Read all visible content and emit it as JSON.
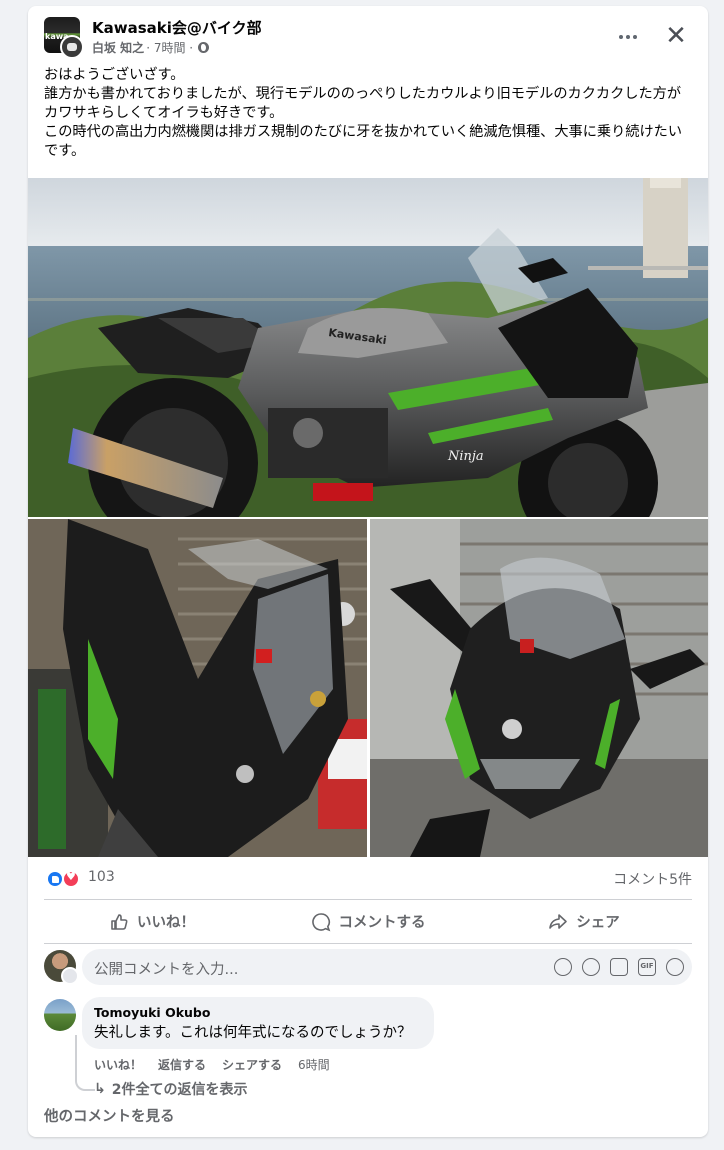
{
  "post": {
    "group_name": "Kawasaki会@バイク部",
    "group_avatar_text": "kawa",
    "author": "白坂 知之",
    "time": "· 7時間 ·",
    "text": "おはようございざす。\n誰方かも書かれておりましたが、現行モデルののっぺりしたカウルより旧モデルのカクカクした方がカワサキらしくてオイラも好きです。\nこの時代の高出力内燃機関は排ガス規制のたびに牙を抜かれていく絶滅危惧種、大事に乗り続けたいです。",
    "photos": [
      "photo-kawasaki-ninja-h2-sx-seaside",
      "photo-ninja-front-left",
      "photo-ninja-front-right"
    ],
    "photo_text": {
      "tank_logo": "Kawasaki",
      "cowl_text": "Ninja"
    }
  },
  "stats": {
    "reaction_count": "103",
    "comment_count": "コメント5件"
  },
  "actions": {
    "like": "いいね！",
    "comment": "コメントする",
    "share": "シェア"
  },
  "composer": {
    "placeholder": "公開コメントを入力...",
    "gif_label": "GIF"
  },
  "comments": [
    {
      "author": "Tomoyuki Okubo",
      "text": "失礼します。これは何年式になるのでしょうか？",
      "like": "いいね！",
      "reply": "返信する",
      "share": "シェアする",
      "time": "6時間",
      "view_replies": "2件全ての返信を表示"
    }
  ],
  "footer": {
    "more_comments": "他のコメントを見る"
  },
  "colors": {
    "accent": "#1877f2",
    "love": "#f33e58",
    "secondary_text": "#65676b",
    "kawasaki_green": "#4caf2a"
  }
}
